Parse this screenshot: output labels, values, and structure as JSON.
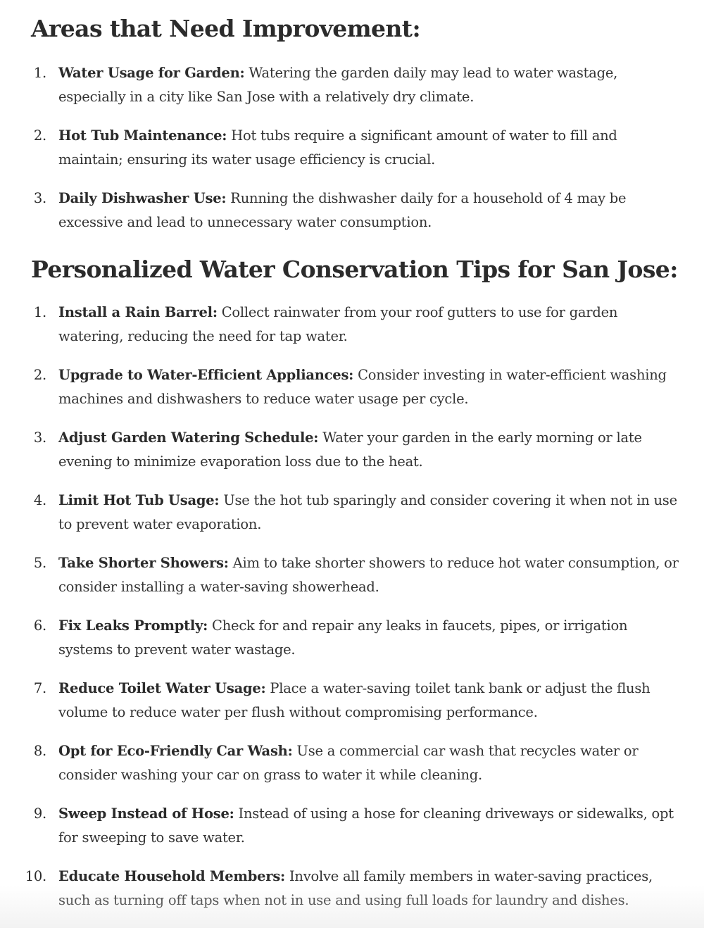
{
  "section1": {
    "title": "Areas that Need Improvement:",
    "items": [
      {
        "num": "1.",
        "title": "Water Usage for Garden:",
        "text": " Watering the garden daily may lead to water wastage, especially in a city like San Jose with a relatively dry climate."
      },
      {
        "num": "2.",
        "title": "Hot Tub Maintenance:",
        "text": " Hot tubs require a significant amount of water to fill and maintain; ensuring its water usage efficiency is crucial."
      },
      {
        "num": "3.",
        "title": "Daily Dishwasher Use:",
        "text": " Running the dishwasher daily for a household of 4 may be excessive and lead to unnecessary water consumption."
      }
    ]
  },
  "section2": {
    "title": "Personalized Water Conservation Tips for San Jose:",
    "items": [
      {
        "num": "1.",
        "title": "Install a Rain Barrel:",
        "text": " Collect rainwater from your roof gutters to use for garden watering, reducing the need for tap water."
      },
      {
        "num": "2.",
        "title": "Upgrade to Water-Efficient Appliances:",
        "text": " Consider investing in water-efficient washing machines and dishwashers to reduce water usage per cycle."
      },
      {
        "num": "3.",
        "title": "Adjust Garden Watering Schedule:",
        "text": " Water your garden in the early morning or late evening to minimize evaporation loss due to the heat."
      },
      {
        "num": "4.",
        "title": "Limit Hot Tub Usage:",
        "text": " Use the hot tub sparingly and consider covering it when not in use to prevent water evaporation."
      },
      {
        "num": "5.",
        "title": "Take Shorter Showers:",
        "text": " Aim to take shorter showers to reduce hot water consumption, or consider installing a water-saving showerhead."
      },
      {
        "num": "6.",
        "title": "Fix Leaks Promptly:",
        "text": " Check for and repair any leaks in faucets, pipes, or irrigation systems to prevent water wastage."
      },
      {
        "num": "7.",
        "title": "Reduce Toilet Water Usage:",
        "text": " Place a water-saving toilet tank bank or adjust the flush volume to reduce water per flush without compromising performance."
      },
      {
        "num": "8.",
        "title": "Opt for Eco-Friendly Car Wash:",
        "text": " Use a commercial car wash that recycles water or consider washing your car on grass to water it while cleaning."
      },
      {
        "num": "9.",
        "title": "Sweep Instead of Hose:",
        "text": " Instead of using a hose for cleaning driveways or sidewalks, opt for sweeping to save water."
      },
      {
        "num": "10.",
        "title": "Educate Household Members:",
        "text": " Involve all family members in water-saving practices, such as turning off taps when not in use and using full loads for laundry and dishes."
      }
    ]
  }
}
